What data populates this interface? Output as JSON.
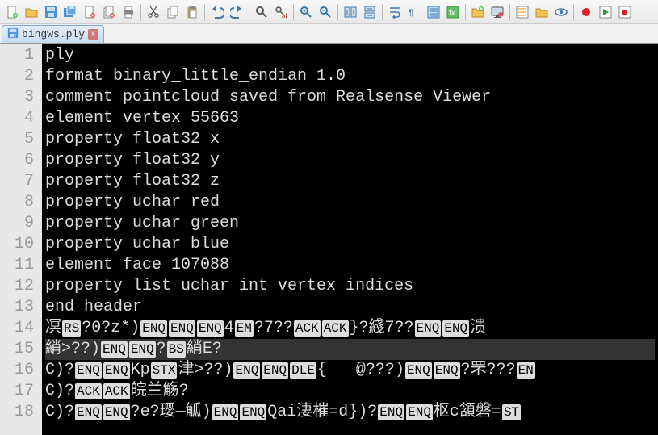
{
  "tab": {
    "filename": "bingws.ply"
  },
  "code_lines": [
    {
      "num": 1,
      "segments": [
        {
          "t": "text",
          "v": "ply"
        }
      ]
    },
    {
      "num": 2,
      "segments": [
        {
          "t": "text",
          "v": "format binary_little_endian 1.0"
        }
      ]
    },
    {
      "num": 3,
      "segments": [
        {
          "t": "text",
          "v": "comment pointcloud saved from Realsense Viewer"
        }
      ]
    },
    {
      "num": 4,
      "segments": [
        {
          "t": "text",
          "v": "element vertex 55663"
        }
      ]
    },
    {
      "num": 5,
      "segments": [
        {
          "t": "text",
          "v": "property float32 x"
        }
      ]
    },
    {
      "num": 6,
      "segments": [
        {
          "t": "text",
          "v": "property float32 y"
        }
      ]
    },
    {
      "num": 7,
      "segments": [
        {
          "t": "text",
          "v": "property float32 z"
        }
      ]
    },
    {
      "num": 8,
      "segments": [
        {
          "t": "text",
          "v": "property uchar red"
        }
      ]
    },
    {
      "num": 9,
      "segments": [
        {
          "t": "text",
          "v": "property uchar green"
        }
      ]
    },
    {
      "num": 10,
      "segments": [
        {
          "t": "text",
          "v": "property uchar blue"
        }
      ]
    },
    {
      "num": 11,
      "segments": [
        {
          "t": "text",
          "v": "element face 107088"
        }
      ]
    },
    {
      "num": 12,
      "segments": [
        {
          "t": "text",
          "v": "property list uchar int vertex_indices"
        }
      ]
    },
    {
      "num": 13,
      "segments": [
        {
          "t": "text",
          "v": "end_header"
        }
      ]
    },
    {
      "num": 14,
      "segments": [
        {
          "t": "text",
          "v": "凕"
        },
        {
          "t": "ctrl",
          "v": "RS"
        },
        {
          "t": "text",
          "v": "?0?z*)"
        },
        {
          "t": "ctrl",
          "v": "ENQ"
        },
        {
          "t": "ctrl",
          "v": "ENQ"
        },
        {
          "t": "ctrl",
          "v": "ENQ"
        },
        {
          "t": "text",
          "v": "4"
        },
        {
          "t": "ctrl",
          "v": "EM"
        },
        {
          "t": "text",
          "v": "?7??"
        },
        {
          "t": "ctrl",
          "v": "ACK"
        },
        {
          "t": "ctrl",
          "v": "ACK"
        },
        {
          "t": "text",
          "v": "}?綫7??"
        },
        {
          "t": "ctrl",
          "v": "ENQ"
        },
        {
          "t": "ctrl",
          "v": "ENQ"
        },
        {
          "t": "text",
          "v": "溃"
        }
      ]
    },
    {
      "num": 15,
      "hl": true,
      "segments": [
        {
          "t": "text",
          "v": "綃>??)"
        },
        {
          "t": "ctrl",
          "v": "ENQ"
        },
        {
          "t": "ctrl",
          "v": "ENQ"
        },
        {
          "t": "text",
          "v": "?"
        },
        {
          "t": "ctrl",
          "v": "BS"
        },
        {
          "t": "text",
          "v": "綃E?"
        }
      ]
    },
    {
      "num": 16,
      "segments": [
        {
          "t": "text",
          "v": "C)?"
        },
        {
          "t": "ctrl",
          "v": "ENQ"
        },
        {
          "t": "ctrl",
          "v": "ENQ"
        },
        {
          "t": "text",
          "v": "Kp"
        },
        {
          "t": "ctrl",
          "v": "STX"
        },
        {
          "t": "text",
          "v": "津>??)"
        },
        {
          "t": "ctrl",
          "v": "ENQ"
        },
        {
          "t": "ctrl",
          "v": "ENQ"
        },
        {
          "t": "ctrl",
          "v": "DLE"
        },
        {
          "t": "text",
          "v": "{   @???)"
        },
        {
          "t": "ctrl",
          "v": "ENQ"
        },
        {
          "t": "ctrl",
          "v": "ENQ"
        },
        {
          "t": "text",
          "v": "?罘???"
        },
        {
          "t": "ctrl",
          "v": "EN"
        }
      ]
    },
    {
      "num": 17,
      "segments": [
        {
          "t": "text",
          "v": "C)?"
        },
        {
          "t": "ctrl",
          "v": "ACK"
        },
        {
          "t": "ctrl",
          "v": "ACK"
        },
        {
          "t": "text",
          "v": "皖兰觞?"
        }
      ]
    },
    {
      "num": 18,
      "segments": [
        {
          "t": "text",
          "v": "C)?"
        },
        {
          "t": "ctrl",
          "v": "ENQ"
        },
        {
          "t": "ctrl",
          "v": "ENQ"
        },
        {
          "t": "text",
          "v": "?e?璎—觚)"
        },
        {
          "t": "ctrl",
          "v": "ENQ"
        },
        {
          "t": "ctrl",
          "v": "ENQ"
        },
        {
          "t": "text",
          "v": "Qai淒槯=d})?"
        },
        {
          "t": "ctrl",
          "v": "ENQ"
        },
        {
          "t": "ctrl",
          "v": "ENQ"
        },
        {
          "t": "text",
          "v": "枢c頷磐="
        },
        {
          "t": "ctrl",
          "v": "ST"
        }
      ]
    }
  ],
  "toolbar_icons": [
    "new-file-icon",
    "open-icon",
    "save-icon",
    "save-all-icon",
    "close-icon",
    "close-all-icon",
    "print-icon",
    "sep",
    "cut-icon",
    "copy-icon",
    "paste-icon",
    "sep",
    "undo-icon",
    "redo-icon",
    "sep",
    "find-icon",
    "replace-icon",
    "sep",
    "zoom-in-icon",
    "zoom-out-icon",
    "sep",
    "sync-v-icon",
    "sync-h-icon",
    "sep",
    "wrap-icon",
    "show-all-icon",
    "indent-guide-icon",
    "lang-icon",
    "sep",
    "folder-up-icon",
    "monitor-icon",
    "sep",
    "func-list-icon",
    "folder-icon",
    "eye-icon",
    "sep",
    "record-icon",
    "play-macro-icon",
    "stop-macro-icon"
  ]
}
